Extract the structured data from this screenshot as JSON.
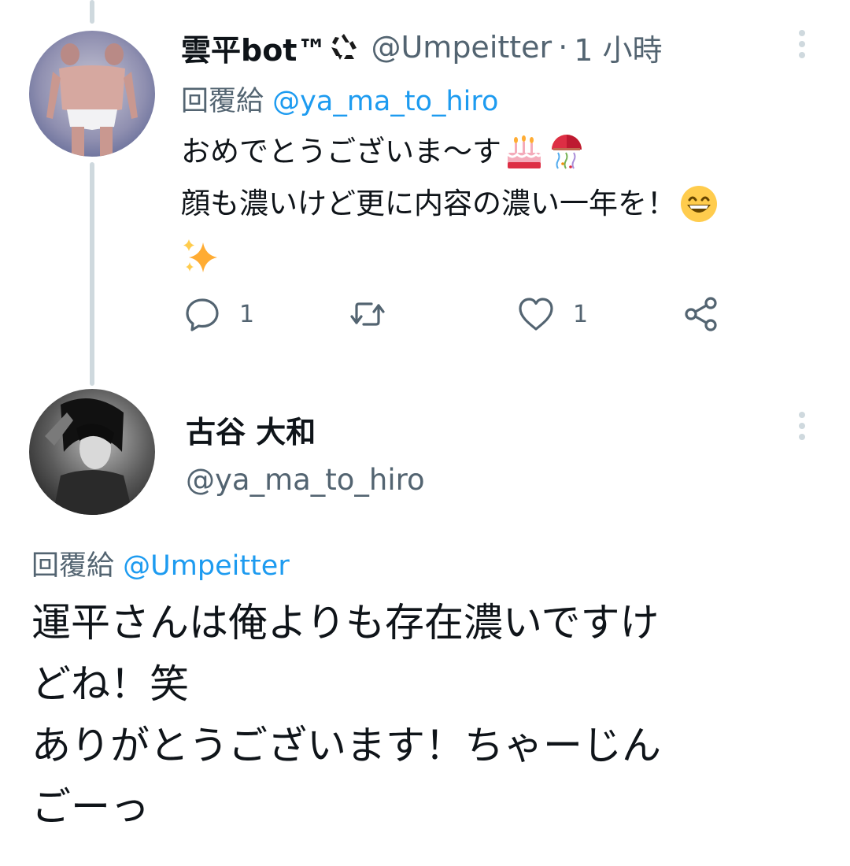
{
  "tweet1": {
    "display_name": "雲平bot™",
    "name_badge_icon": "recycle-icon",
    "handle": "@Umpeitter",
    "separator": "·",
    "timestamp": "1 小時",
    "replying_label": "回覆給",
    "replying_to": "@ya_ma_to_hiro",
    "text_lines": [
      "おめでとうございま〜す",
      "顔も濃いけど更に内容の濃い一年を！"
    ],
    "emojis": [
      "birthday-cake-emoji",
      "confetti-ball-emoji",
      "grinning-face-emoji",
      "sparkles-emoji"
    ],
    "actions": {
      "reply_count": "1",
      "retweet_count": "",
      "like_count": "1"
    }
  },
  "tweet2": {
    "display_name": "古谷 大和",
    "handle": "@ya_ma_to_hiro",
    "replying_label": "回覆給",
    "replying_to": "@Umpeitter",
    "text_lines": [
      "運平さんは俺よりも存在濃いですけ",
      "どね！笑",
      "ありがとうございます！ちゃーじん",
      "ごーっ"
    ]
  },
  "colors": {
    "text": "#0f1419",
    "secondary": "#536471",
    "link": "#1d9bf0",
    "thread_line": "#cfd9de"
  }
}
